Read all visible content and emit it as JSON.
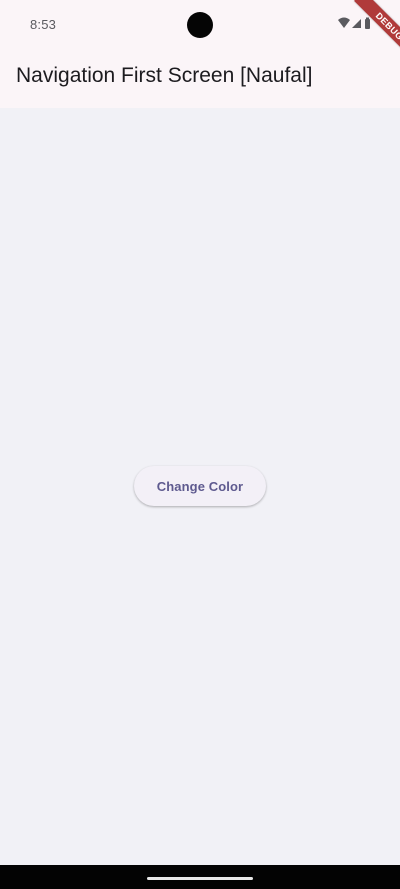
{
  "status_bar": {
    "time": "8:53",
    "icons": [
      "wifi-icon",
      "signal-icon",
      "battery-icon"
    ]
  },
  "app_bar": {
    "title": "Navigation First Screen [Naufal]"
  },
  "main": {
    "button_label": "Change Color"
  },
  "debug_banner": {
    "label": "DEBUG"
  },
  "colors": {
    "surface": "#fbf5f8",
    "background": "#f1f1f6",
    "button_text": "#5e5a8f",
    "debug": "#b03a3a"
  }
}
